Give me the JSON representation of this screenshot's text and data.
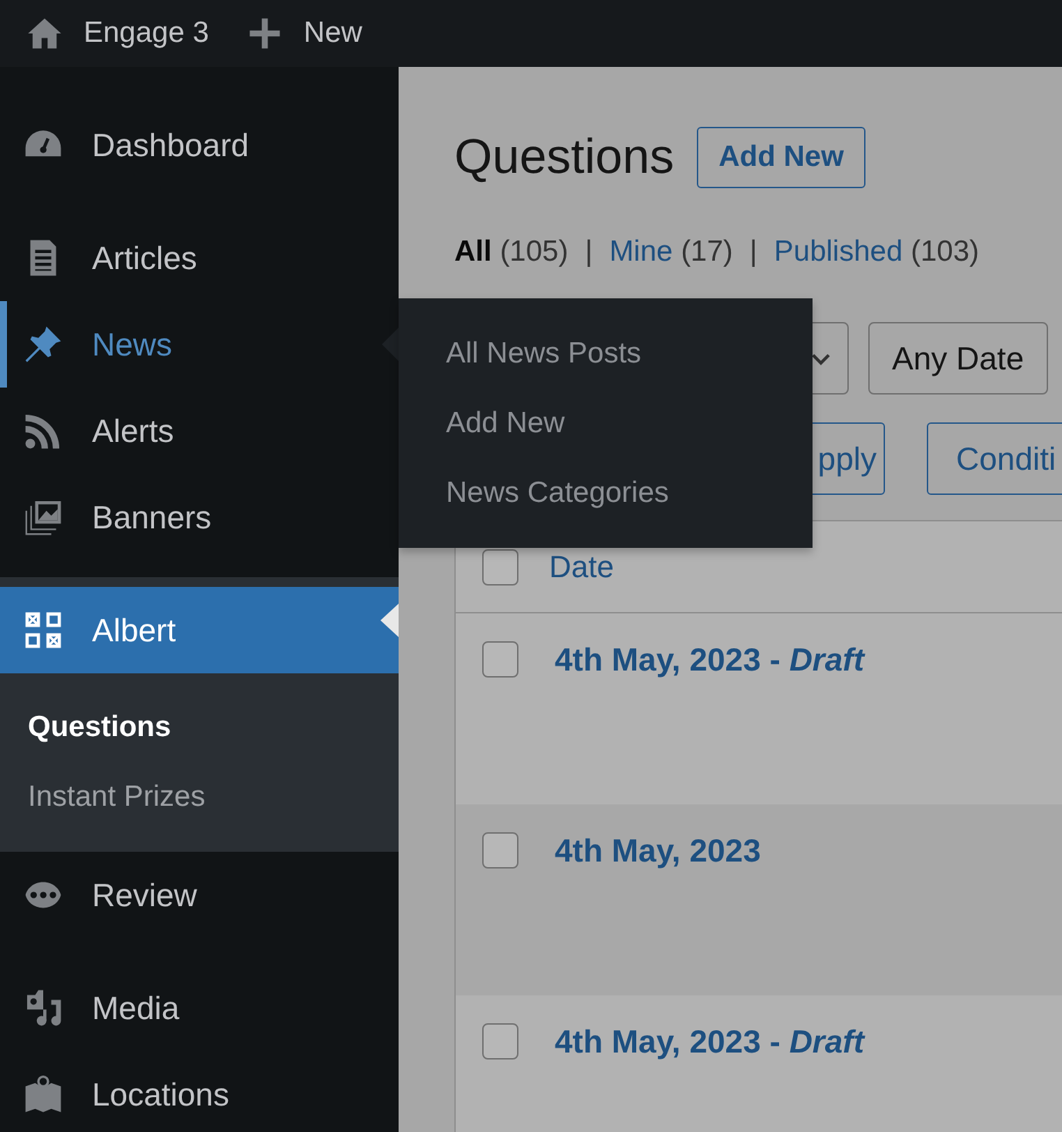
{
  "admin_bar": {
    "items": [
      {
        "label": "Engage 3"
      },
      {
        "label": "New"
      }
    ]
  },
  "sidebar": {
    "groups": [
      {
        "items": [
          {
            "label": "Dashboard",
            "selected": false,
            "hovered": false
          }
        ]
      },
      {
        "items": [
          {
            "label": "Articles",
            "selected": false,
            "hovered": false
          },
          {
            "label": "News",
            "selected": false,
            "hovered": true,
            "flyout": [
              {
                "label": "All News Posts"
              },
              {
                "label": "Add New"
              },
              {
                "label": "News Categories"
              }
            ]
          },
          {
            "label": "Alerts",
            "selected": false,
            "hovered": false
          },
          {
            "label": "Banners",
            "selected": false,
            "hovered": false
          }
        ]
      },
      {
        "items": [
          {
            "label": "Albert",
            "selected": true,
            "hovered": false,
            "submenu": [
              {
                "label": "Questions",
                "selected": true
              },
              {
                "label": "Instant Prizes",
                "selected": false
              }
            ]
          },
          {
            "label": "Review",
            "selected": false,
            "hovered": false
          }
        ]
      },
      {
        "items": [
          {
            "label": "Media",
            "selected": false,
            "hovered": false
          },
          {
            "label": "Locations",
            "selected": false,
            "hovered": false
          }
        ]
      }
    ]
  },
  "page": {
    "title": "Questions",
    "add_button": "Add New",
    "views": [
      {
        "label": "All",
        "count": "(105)",
        "selected": true
      },
      {
        "separator": "|",
        "label": "Mine",
        "count": "(17)",
        "selected": false
      },
      {
        "separator": "|",
        "label": "Published",
        "count": "(103)",
        "selected": false
      }
    ],
    "filters": [
      {
        "kind": "select"
      },
      {
        "kind": "select",
        "value": "Any Date"
      }
    ],
    "actions": [
      {
        "label": "pply"
      },
      {
        "label": "Conditi"
      }
    ]
  },
  "table": {
    "select_all": {
      "checked": false
    },
    "columns": [
      {
        "label": "Date"
      }
    ],
    "rows": [
      {
        "title": "4th May, 2023 - *Draft*",
        "checked": false
      },
      {
        "title": "4th May, 2023",
        "checked": false
      },
      {
        "title": "4th May, 2023 - *Draft*",
        "checked": false
      }
    ]
  }
}
